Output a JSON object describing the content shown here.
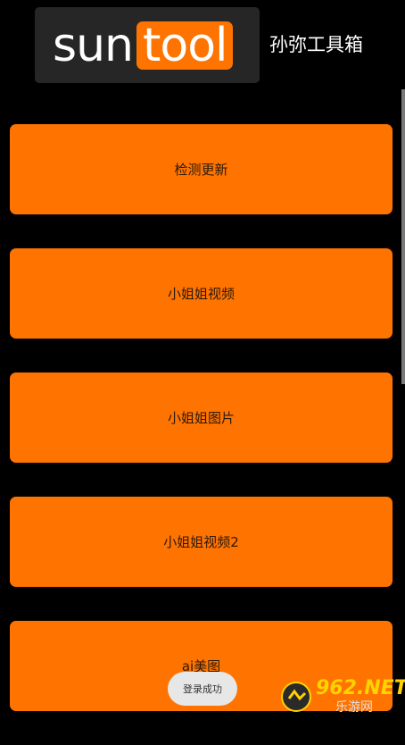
{
  "header": {
    "logo_part1": "sun",
    "logo_part2": "tool",
    "app_title": "孙弥工具箱"
  },
  "menu": {
    "items": [
      {
        "label": "检测更新"
      },
      {
        "label": "小姐姐视频"
      },
      {
        "label": "小姐姐图片"
      },
      {
        "label": "小姐姐视频2"
      },
      {
        "label": "ai美图"
      }
    ]
  },
  "toast": {
    "message": "登录成功"
  },
  "watermark": {
    "brand": "962.NET",
    "tagline": "乐游网"
  },
  "colors": {
    "background": "#000000",
    "accent": "#ff7300",
    "logo_bg": "#262626",
    "toast_bg": "#e7e7e7"
  }
}
